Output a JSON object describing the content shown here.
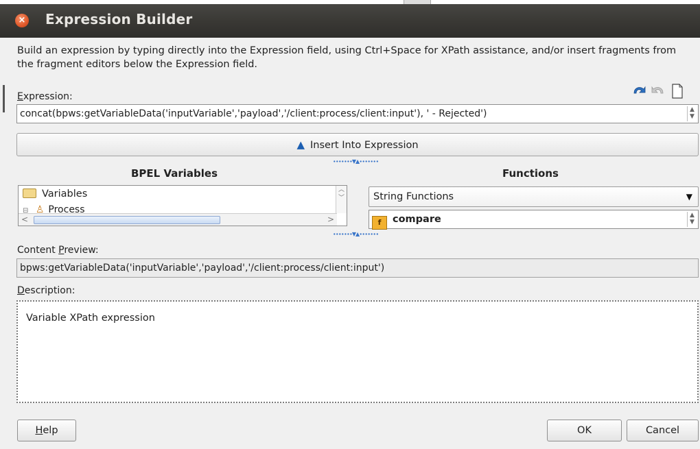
{
  "window": {
    "title": "Expression Builder",
    "close_icon": "close-icon"
  },
  "intro_text": "Build an expression by typing directly into the Expression field, using Ctrl+Space for XPath assistance, and/or insert fragments from the fragment editors below the Expression field.",
  "expression": {
    "label": "Expression:",
    "value": "concat(bpws:getVariableData('inputVariable','payload','/client:process/client:input'), ' - Rejected')",
    "toolbar_icons": [
      "undo-icon",
      "redo-icon",
      "new-document-icon"
    ]
  },
  "insert_button": {
    "label": "Insert Into Expression",
    "icon": "up-arrow-icon"
  },
  "bpel_variables": {
    "heading": "BPEL Variables",
    "tree": [
      {
        "label": "Variables",
        "icon": "folder-icon"
      },
      {
        "label": "Process",
        "icon": "process-icon"
      }
    ]
  },
  "functions": {
    "heading": "Functions",
    "category": "String Functions",
    "selected_function": "compare",
    "function_icon": "function-icon"
  },
  "content_preview": {
    "label": "Content Preview:",
    "value": "bpws:getVariableData('inputVariable','payload','/client:process/client:input')"
  },
  "description": {
    "label": "Description:",
    "value": "Variable XPath expression"
  },
  "buttons": {
    "help": "Help",
    "ok": "OK",
    "cancel": "Cancel"
  }
}
